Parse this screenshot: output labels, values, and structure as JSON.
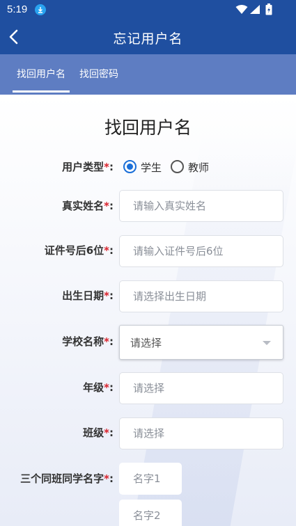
{
  "status_bar": {
    "time": "5:19"
  },
  "app_bar": {
    "title": "忘记用户名"
  },
  "tabs": [
    {
      "label": "找回用户名",
      "active": true
    },
    {
      "label": "找回密码",
      "active": false
    }
  ],
  "form": {
    "title": "找回用户名",
    "required_mark": "*",
    "user_type": {
      "label": "用户类型",
      "options": [
        {
          "label": "学生",
          "checked": true
        },
        {
          "label": "教师",
          "checked": false
        }
      ]
    },
    "real_name": {
      "label": "真实姓名",
      "placeholder": "请输入真实姓名"
    },
    "id_last6": {
      "label": "证件号后6位",
      "placeholder": "请输入证件号后6位"
    },
    "birth_date": {
      "label": "出生日期",
      "placeholder": "请选择出生日期"
    },
    "school": {
      "label": "学校名称",
      "value": "请选择"
    },
    "grade": {
      "label": "年级",
      "placeholder": "请选择"
    },
    "class": {
      "label": "班级",
      "placeholder": "请选择"
    },
    "classmates": {
      "label": "三个同班同学名字",
      "name1_placeholder": "名字1",
      "name2_placeholder": "名字2"
    }
  },
  "colors": {
    "app_bar": "#1f4fa0",
    "tab_bar": "#5e7dc2",
    "accent": "#1a6fd8",
    "required": "#d9232d"
  }
}
